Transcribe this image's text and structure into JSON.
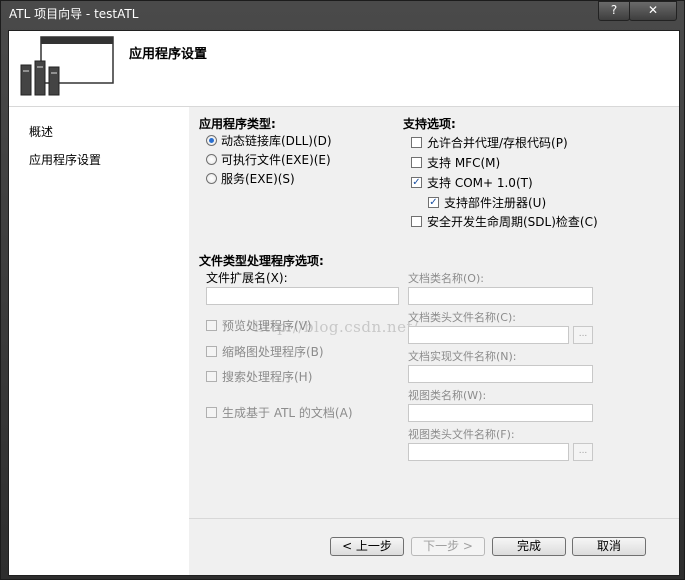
{
  "window": {
    "title": "ATL 项目向导 - testATL",
    "help_label": "?",
    "close_label": "✕"
  },
  "banner": {
    "title": "应用程序设置",
    "icon": "app-settings-icon"
  },
  "nav": {
    "items": [
      "概述",
      "应用程序设置"
    ]
  },
  "app_type": {
    "title": "应用程序类型:",
    "options": [
      {
        "label": "动态链接库(DLL)(D)",
        "selected": true
      },
      {
        "label": "可执行文件(EXE)(E)",
        "selected": false
      },
      {
        "label": "服务(EXE)(S)",
        "selected": false
      }
    ]
  },
  "support": {
    "title": "支持选项:",
    "options": [
      {
        "label": "允许合并代理/存根代码(P)",
        "checked": false
      },
      {
        "label": "支持 MFC(M)",
        "checked": false
      },
      {
        "label": "支持 COM+ 1.0(T)",
        "checked": true
      },
      {
        "label": "支持部件注册器(U)",
        "checked": true
      },
      {
        "label": "安全开发生命周期(SDL)检查(C)",
        "checked": false
      }
    ]
  },
  "filetype": {
    "title": "文件类型处理程序选项:",
    "ext_label": "文件扩展名(X):",
    "ext_value": "",
    "handlers": [
      {
        "label": "预览处理程序(V)",
        "checked": false
      },
      {
        "label": "缩略图处理程序(B)",
        "checked": false
      },
      {
        "label": "搜索处理程序(H)",
        "checked": false
      },
      {
        "label": "生成基于 ATL 的文档(A)",
        "checked": false
      }
    ],
    "fields": [
      {
        "label": "文档类名称(O):",
        "value": ""
      },
      {
        "label": "文档类头文件名称(C):",
        "value": ""
      },
      {
        "label": "文档实现文件名称(N):",
        "value": ""
      },
      {
        "label": "视图类名称(W):",
        "value": ""
      },
      {
        "label": "视图类头文件名称(F):",
        "value": ""
      }
    ],
    "browse_label": "..."
  },
  "watermark": "http://blog.csdn.net/",
  "buttons": {
    "back": "< 上一步",
    "next": "下一步 >",
    "finish": "完成",
    "cancel": "取消"
  }
}
